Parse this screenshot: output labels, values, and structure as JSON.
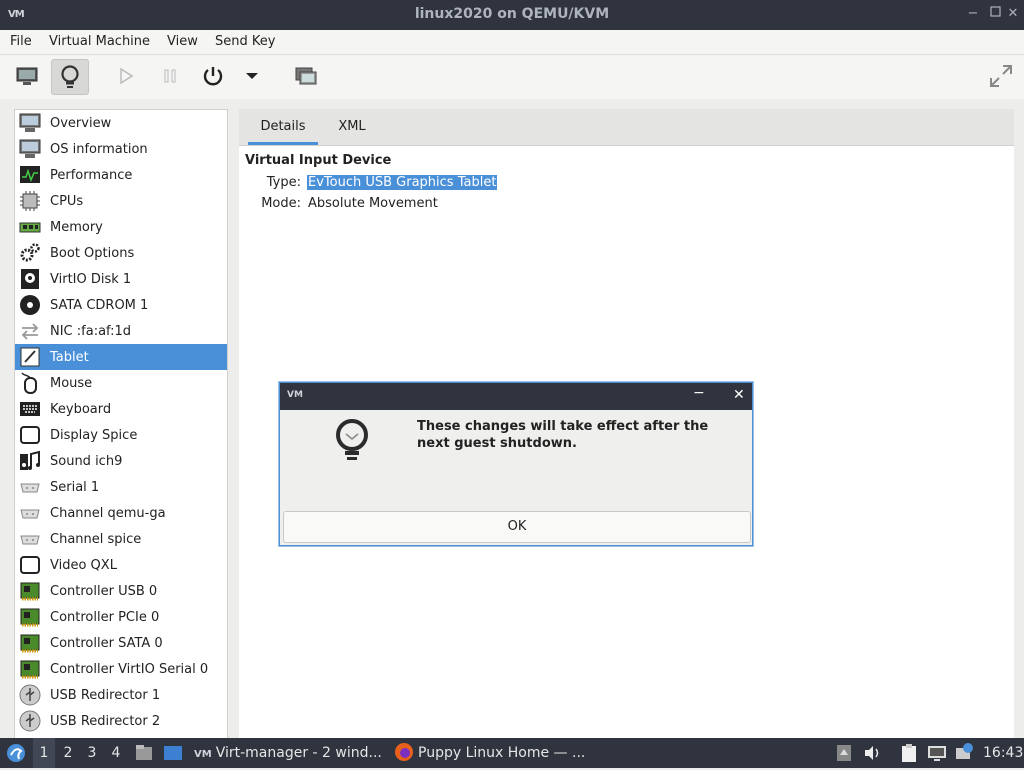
{
  "window": {
    "title": "linux2020 on QEMU/KVM",
    "logo": "VM"
  },
  "menu": [
    "File",
    "Virtual Machine",
    "View",
    "Send Key"
  ],
  "sidebar": {
    "items": [
      {
        "label": "Overview",
        "icon": "monitor-icon"
      },
      {
        "label": "OS information",
        "icon": "monitor-icon"
      },
      {
        "label": "Performance",
        "icon": "performance-graph-icon"
      },
      {
        "label": "CPUs",
        "icon": "cpu-chip-icon"
      },
      {
        "label": "Memory",
        "icon": "memory-module-icon"
      },
      {
        "label": "Boot Options",
        "icon": "gears-icon"
      },
      {
        "label": "VirtIO Disk 1",
        "icon": "disk-icon"
      },
      {
        "label": "SATA CDROM 1",
        "icon": "cdrom-icon"
      },
      {
        "label": "NIC :fa:af:1d",
        "icon": "network-arrows-icon"
      },
      {
        "label": "Tablet",
        "icon": "tablet-icon"
      },
      {
        "label": "Mouse",
        "icon": "mouse-icon"
      },
      {
        "label": "Keyboard",
        "icon": "keyboard-icon"
      },
      {
        "label": "Display Spice",
        "icon": "display-icon"
      },
      {
        "label": "Sound ich9",
        "icon": "sound-icon"
      },
      {
        "label": "Serial 1",
        "icon": "serial-port-icon"
      },
      {
        "label": "Channel qemu-ga",
        "icon": "channel-icon"
      },
      {
        "label": "Channel spice",
        "icon": "channel-icon"
      },
      {
        "label": "Video QXL",
        "icon": "video-icon"
      },
      {
        "label": "Controller USB 0",
        "icon": "controller-card-icon"
      },
      {
        "label": "Controller PCIe 0",
        "icon": "controller-card-icon"
      },
      {
        "label": "Controller SATA 0",
        "icon": "controller-card-icon"
      },
      {
        "label": "Controller VirtIO Serial 0",
        "icon": "controller-card-icon"
      },
      {
        "label": "USB Redirector 1",
        "icon": "usb-redirector-icon"
      },
      {
        "label": "USB Redirector 2",
        "icon": "usb-redirector-icon"
      }
    ],
    "selected": "Tablet"
  },
  "tabs": [
    "Details",
    "XML"
  ],
  "details": {
    "heading": "Virtual Input Device",
    "type_label": "Type:",
    "type_value": "EvTouch USB Graphics Tablet",
    "mode_label": "Mode:",
    "mode_value": "Absolute Movement"
  },
  "dialog": {
    "logo": "VM",
    "message": "These changes will take effect after the next guest shutdown.",
    "ok_label": "OK",
    "icon": "lightbulb-icon"
  },
  "taskbar": {
    "workspaces": [
      "1",
      "2",
      "3",
      "4"
    ],
    "current_workspace": "1",
    "tasks": [
      "Virt-manager - 2 wind...",
      "Puppy Linux Home — ..."
    ],
    "clock": "16:43"
  },
  "colors": {
    "selection": "#4a90d9",
    "titlebar": "#2f343f"
  }
}
